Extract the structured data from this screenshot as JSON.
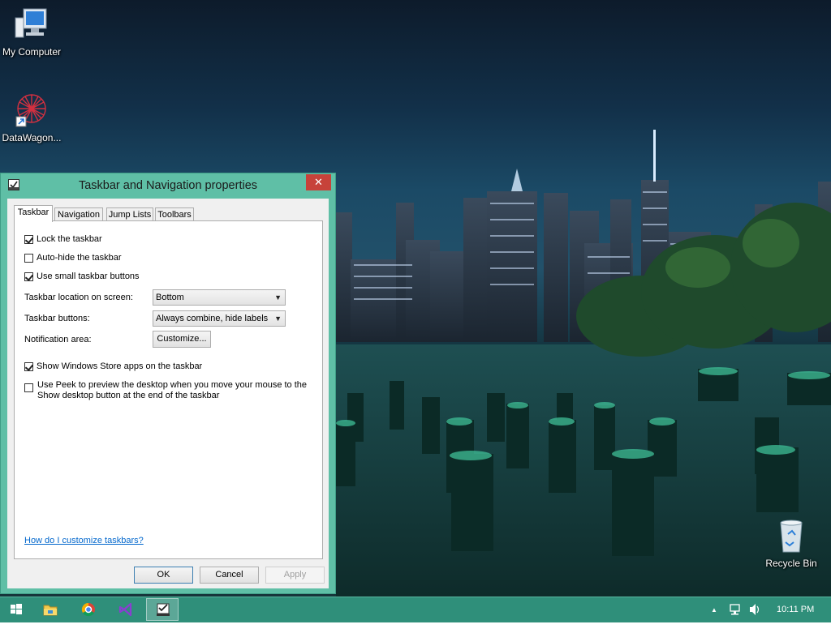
{
  "desktop": {
    "icons": [
      {
        "label": "My Computer"
      },
      {
        "label": "DataWagon..."
      },
      {
        "label": "Recycle Bin"
      }
    ]
  },
  "dialog": {
    "title": "Taskbar and Navigation properties",
    "close_symbol": "✕",
    "tabs": [
      "Taskbar",
      "Navigation",
      "Jump Lists",
      "Toolbars"
    ],
    "active_tab": "Taskbar",
    "options": {
      "lock_taskbar": {
        "label": "Lock the taskbar",
        "checked": true
      },
      "auto_hide": {
        "label": "Auto-hide the taskbar",
        "checked": false
      },
      "small_buttons": {
        "label": "Use small taskbar buttons",
        "checked": true
      },
      "store_apps": {
        "label": "Show Windows Store apps on the taskbar",
        "checked": true
      },
      "peek_line1": {
        "label": "Use Peek to preview the desktop when you move your mouse to the",
        "checked": false
      },
      "peek_line2": {
        "label": "Show desktop button at the end of the taskbar"
      }
    },
    "location": {
      "label": "Taskbar location on screen:",
      "value": "Bottom"
    },
    "buttons_setting": {
      "label": "Taskbar buttons:",
      "value": "Always combine, hide labels"
    },
    "notification": {
      "label": "Notification area:",
      "button": "Customize..."
    },
    "help_link": "How do I customize taskbars?",
    "footer": {
      "ok": "OK",
      "cancel": "Cancel",
      "apply": "Apply"
    }
  },
  "taskbar": {
    "pinned": [
      "start-icon",
      "file-explorer-icon",
      "chrome-icon",
      "visual-studio-icon",
      "taskbar-properties-icon"
    ],
    "tray": {
      "time": "10:11 PM"
    }
  },
  "colors": {
    "accent": "#5fbfa6",
    "taskbar": "#2f8f7a",
    "close": "#c7423a",
    "link": "#0066cc"
  }
}
